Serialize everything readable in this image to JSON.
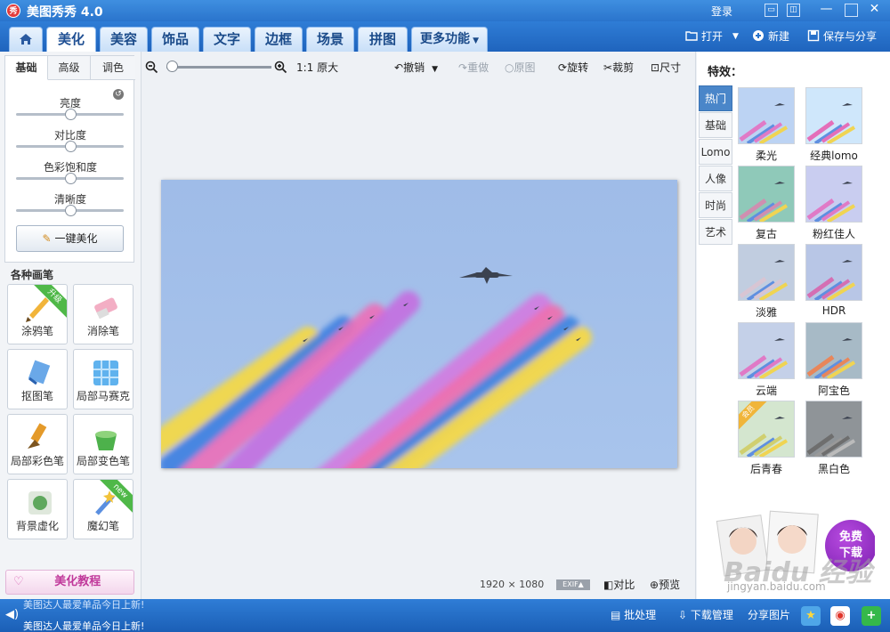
{
  "app": {
    "title": "美图秀秀 4.0",
    "login": "登录",
    "logo_text": "秀"
  },
  "tabs": [
    "美化",
    "美容",
    "饰品",
    "文字",
    "边框",
    "场景",
    "拼图",
    "更多功能"
  ],
  "topbar": {
    "open": "打开",
    "new": "新建",
    "save_share": "保存与分享"
  },
  "left": {
    "subtabs": [
      "基础",
      "高级",
      "调色"
    ],
    "sliders": [
      {
        "label": "亮度",
        "value": 0.5
      },
      {
        "label": "对比度",
        "value": 0.5
      },
      {
        "label": "色彩饱和度",
        "value": 0.5
      },
      {
        "label": "清晰度",
        "value": 0.5
      }
    ],
    "one_click": "一键美化",
    "brushes_title": "各种画笔",
    "brushes": [
      {
        "label": "涂鸦笔",
        "ribbon": "升级"
      },
      {
        "label": "消除笔"
      },
      {
        "label": "抠图笔"
      },
      {
        "label": "局部马赛克"
      },
      {
        "label": "局部彩色笔"
      },
      {
        "label": "局部变色笔"
      },
      {
        "label": "背景虚化"
      },
      {
        "label": "魔幻笔",
        "ribbon": "new"
      }
    ],
    "tutorial": "美化教程"
  },
  "toolbar": {
    "actual_size": "1:1 原大",
    "undo": "撤销",
    "redo": "重做",
    "original": "原图",
    "rotate": "旋转",
    "crop": "裁剪",
    "resize": "尺寸",
    "zoom_level": 0.05
  },
  "image": {
    "width": "1920",
    "height": "1080",
    "times": "×",
    "exif": "EXIF▲",
    "compare": "对比",
    "preview": "预览"
  },
  "right": {
    "title": "特效：",
    "categories": [
      "热门",
      "基础",
      "Lomo",
      "人像",
      "时尚",
      "艺术"
    ],
    "effects": [
      "柔光",
      "经典lomo",
      "复古",
      "粉红佳人",
      "淡雅",
      "HDR",
      "云端",
      "阿宝色",
      "后青春",
      "黑白色"
    ],
    "effect_badge": "会员",
    "ad": {
      "button": "免费\n下载"
    },
    "watermark": "Baidu 经验",
    "watermark_url": "jingyan.baidu.com"
  },
  "status": {
    "news1": "美图达人最爱单品今日上新!",
    "news2": "美图达人最爱单品今日上新!",
    "batch": "批处理",
    "download": "下载管理",
    "share": "分享图片"
  }
}
